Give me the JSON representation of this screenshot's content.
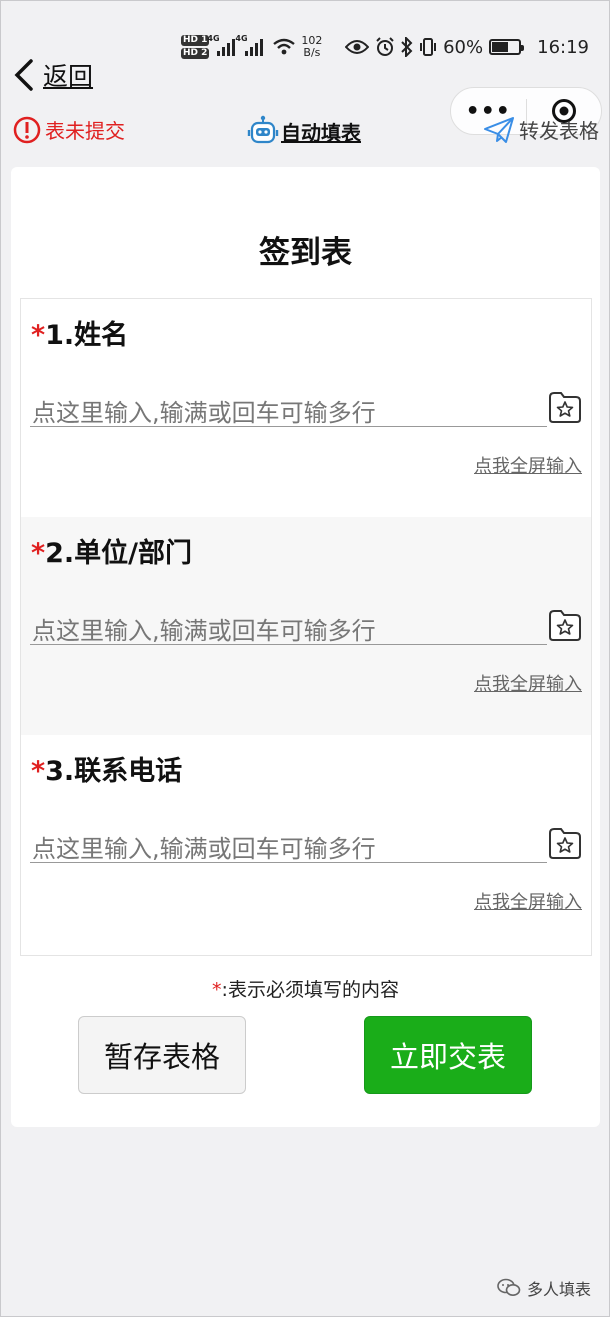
{
  "status_bar": {
    "hd1": "HD 1",
    "hd2": "HD 2",
    "net1": "4G",
    "net2": "4G",
    "speed_value": "102",
    "speed_unit": "B/s",
    "battery": "60%",
    "battery_level": 0.6,
    "time": "16:19"
  },
  "nav": {
    "back_label": "返回"
  },
  "toolbar": {
    "unsubmitted_label": "表未提交",
    "autofill_label": "自动填表",
    "forward_label": "转发表格"
  },
  "form": {
    "title": "签到表",
    "fields": [
      {
        "required": "*",
        "label": "1.姓名",
        "placeholder": "点这里输入,输满或回车可输多行",
        "fullscreen": "点我全屏输入"
      },
      {
        "required": "*",
        "label": "2.单位/部门",
        "placeholder": "点这里输入,输满或回车可输多行",
        "fullscreen": "点我全屏输入"
      },
      {
        "required": "*",
        "label": "3.联系电话",
        "placeholder": "点这里输入,输满或回车可输多行",
        "fullscreen": "点我全屏输入"
      }
    ],
    "required_note_star": "*",
    "required_note": ":表示必须填写的内容",
    "save_label": "暂存表格",
    "submit_label": "立即交表"
  },
  "watermark": {
    "text": "多人填表"
  },
  "colors": {
    "accent_green": "#1aad19",
    "warning_red": "#e02020"
  }
}
